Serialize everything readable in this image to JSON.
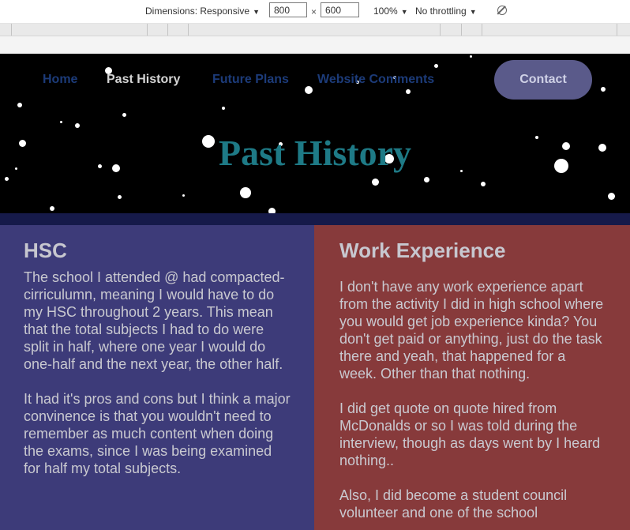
{
  "devtools": {
    "dimensions_label": "Dimensions: Responsive",
    "width_value": "800",
    "height_value": "600",
    "times": "×",
    "zoom_label": "100%",
    "throttle_label": "No throttling"
  },
  "nav": {
    "items": [
      {
        "label": "Home",
        "color": "#1c3b79"
      },
      {
        "label": "Past History",
        "color": "#d4d4d4"
      },
      {
        "label": "Future Plans",
        "color": "#1c3b79"
      },
      {
        "label": "Website Comments",
        "color": "#1c3b79"
      }
    ],
    "contact_label": "Contact"
  },
  "hero": {
    "title": "Past History"
  },
  "sections": {
    "hsc": {
      "heading": "HSC",
      "paragraphs": [
        "The school I attended @ had compacted-cirriculumn, meaning I would have to do my HSC throughout 2 years. This mean that the total subjects I had to do were split in half, where one year I would do one-half and the next year, the other half.",
        "It had it's pros and cons but I think a major convinence is that you wouldn't need to remember as much content when doing the exams, since I was being examined for half my total subjects."
      ]
    },
    "work": {
      "heading": "Work Experience",
      "paragraphs": [
        "I don't have any work experience apart from the activity I did in high school where you would get job experience kinda? You don't get paid or anything, just do the task there and yeah, that happened for a week. Other than that nothing.",
        "I did get quote on quote hired from McDonalds or so I was told during the interview, though as days went by I heard nothing..",
        "Also, I did become a student council volunteer and one of the school"
      ]
    }
  },
  "colors": {
    "hero_bg": "#000000",
    "title": "#1e7a86",
    "left_panel": "#3d3b79",
    "right_panel": "#873a3b",
    "band": "#161a4a"
  }
}
